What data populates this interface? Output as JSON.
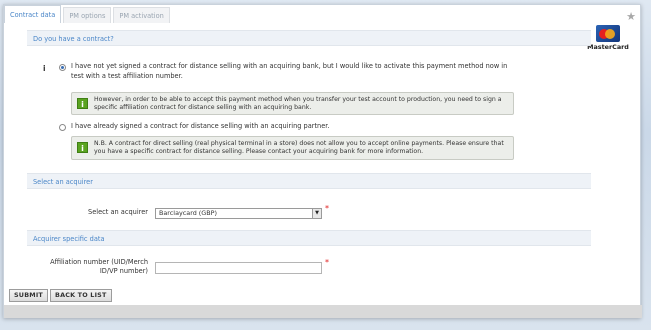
{
  "tabs": [
    {
      "label": "Contract data",
      "active": true
    },
    {
      "label": "PM options",
      "active": false
    },
    {
      "label": "PM activation",
      "active": false
    }
  ],
  "logo": {
    "text": "MasterCard"
  },
  "contract": {
    "header": "Do you have a contract?",
    "option1_text": "I have not yet signed a contract for distance selling with an acquiring bank, but I would like to activate this payment method now in test with a test affiliation number.",
    "option1_checked": true,
    "notice1": "However, in order to be able to accept this payment method when you transfer your test account to production, you need to sign a specific affiliation contract for distance selling with an acquiring bank.",
    "option2_text": "I have already signed a contract for distance selling with an acquiring partner.",
    "option2_checked": false,
    "notice2": "N.B. A contract for direct selling (real physical terminal in a store) does not allow you to accept online payments. Please ensure that you have a specific contract for distance selling. Please contact your acquiring bank for more information."
  },
  "acquirer": {
    "header": "Select an acquirer",
    "label": "Select an acquirer",
    "selected": "Barclaycard (GBP)"
  },
  "acquirer_data": {
    "header": "Acquirer specific data",
    "label": "Affiliation number (UID/Merch ID/VP number)",
    "value": ""
  },
  "buttons": {
    "submit": "SUBMIT",
    "back": "BACK TO LIST"
  },
  "colors": {
    "accent": "#4a86c8",
    "notice_icon": "#5aa320",
    "required": "#e02020"
  }
}
